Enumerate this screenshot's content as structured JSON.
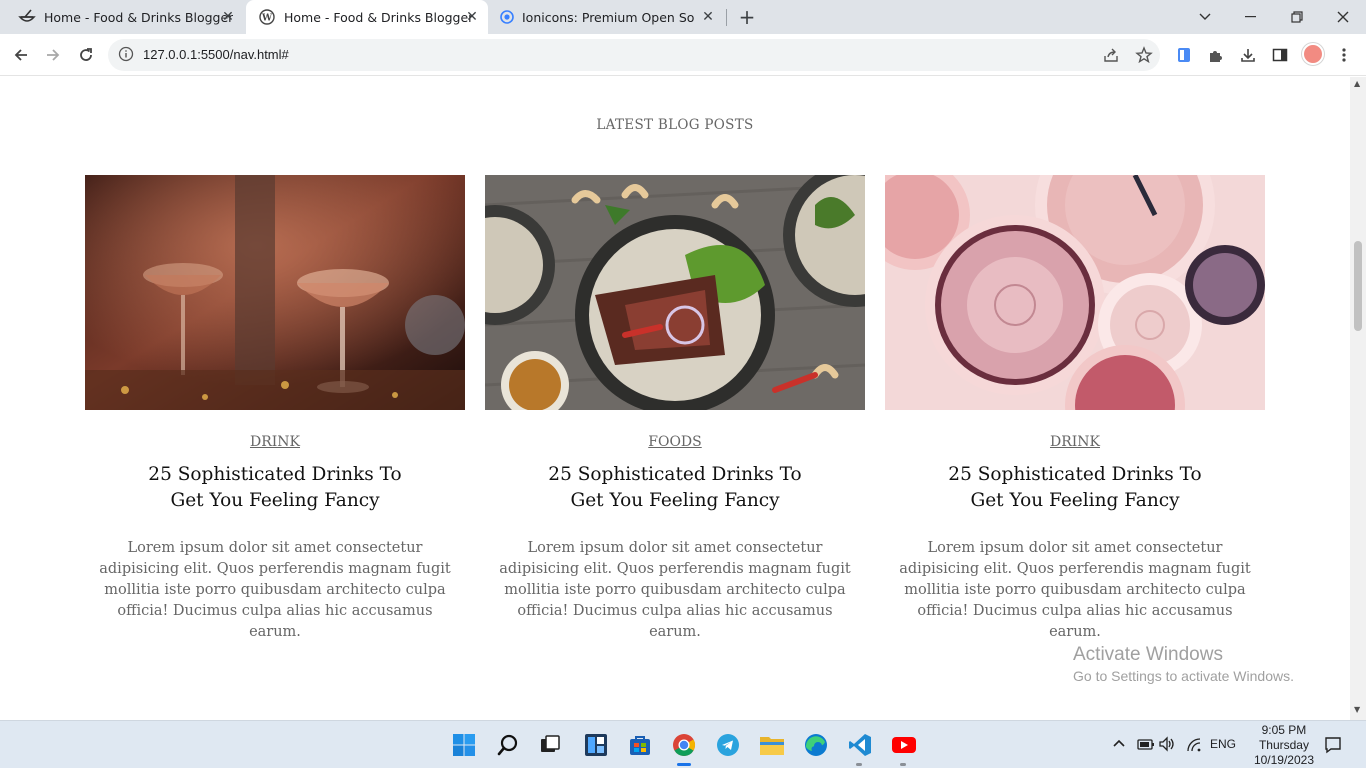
{
  "browser": {
    "tabs": [
      {
        "title": "Home - Food & Drinks Blogger",
        "icon": "bowl-icon",
        "active": false
      },
      {
        "title": "Home - Food & Drinks Blogger",
        "icon": "wordpress-icon",
        "active": true
      },
      {
        "title": "Ionicons: Premium Open Source",
        "icon": "ionicons-icon",
        "active": false
      }
    ],
    "url": "127.0.0.1:5500/nav.html#"
  },
  "page": {
    "section_title": "LATEST BLOG POSTS",
    "posts": [
      {
        "category": "DRINK",
        "title": "25 Sophisticated Drinks To Get You Feeling Fancy",
        "excerpt": "Lorem ipsum dolor sit amet consectetur adipisicing elit. Quos perferendis magnam fugit mollitia iste porro quibusdam architecto culpa officia! Ducimus culpa alias hic accusamus earum.",
        "image": "champagne-glasses-photo"
      },
      {
        "category": "FOODS",
        "title": "25 Sophisticated Drinks To Get You Feeling Fancy",
        "excerpt": "Lorem ipsum dolor sit amet consectetur adipisicing elit. Quos perferendis magnam fugit mollitia iste porro quibusdam architecto culpa officia! Ducimus culpa alias hic accusamus earum.",
        "image": "steak-salad-plate-photo"
      },
      {
        "category": "DRINK",
        "title": "25 Sophisticated Drinks To Get You Feeling Fancy",
        "excerpt": "Lorem ipsum dolor sit amet consectetur adipisicing elit. Quos perferendis magnam fugit mollitia iste porro quibusdam architecto culpa officia! Ducimus culpa alias hic accusamus earum.",
        "image": "pink-cocktails-photo"
      }
    ]
  },
  "watermark": {
    "line1": "Activate Windows",
    "line2": "Go to Settings to activate Windows."
  },
  "taskbar": {
    "apps": [
      "windows-start-icon",
      "search-icon",
      "task-view-icon",
      "widgets-icon",
      "store-icon",
      "chrome-icon",
      "telegram-icon",
      "file-explorer-icon",
      "edge-icon",
      "vscode-icon",
      "youtube-icon"
    ],
    "language": "ENG",
    "time": "9:05 PM",
    "day": "Thursday",
    "date": "10/19/2023"
  },
  "colors": {
    "accent_blue": "#1a73e8",
    "chrome_tab_bg": "#dfe3e8",
    "taskbar_bg": "#dfe8f2"
  }
}
